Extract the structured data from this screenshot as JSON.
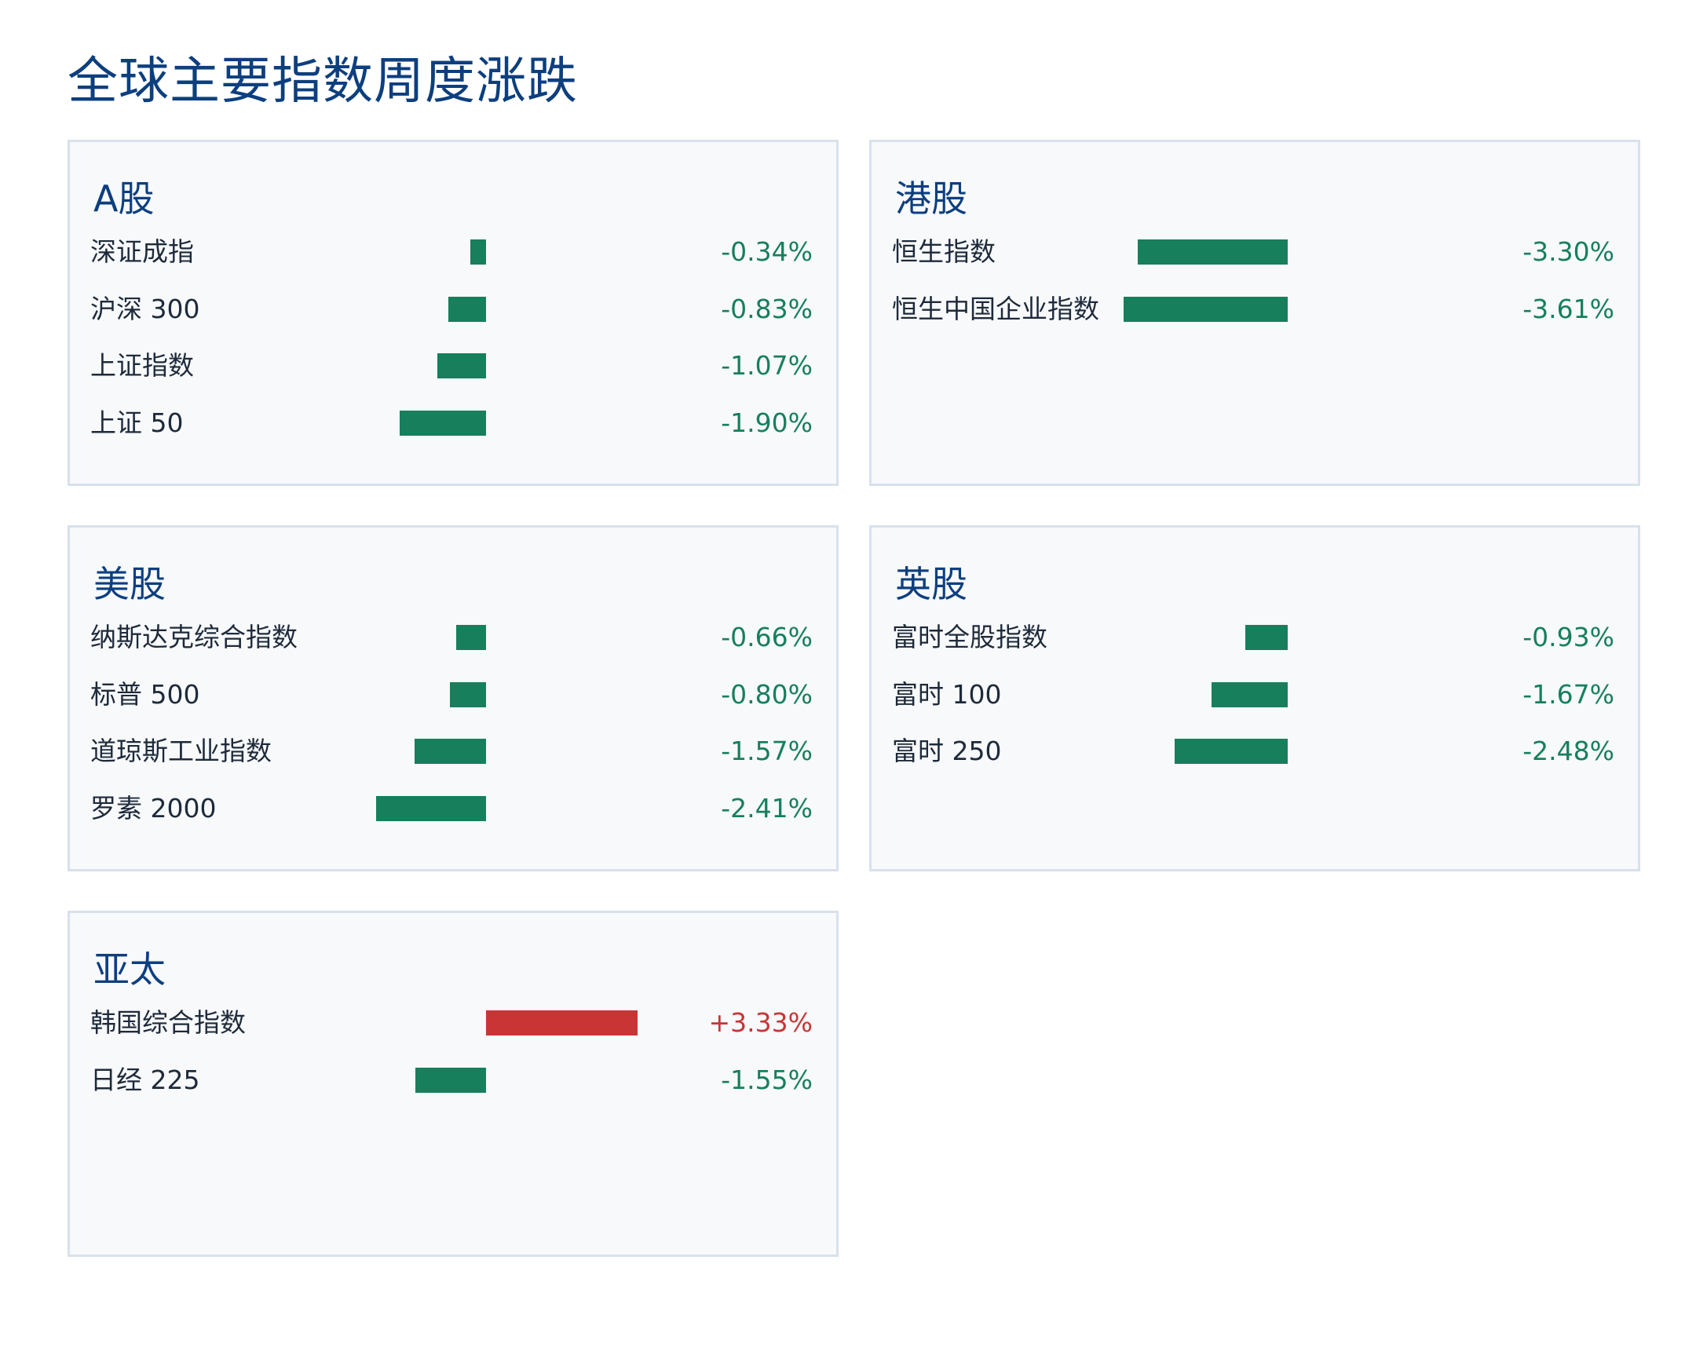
{
  "title": "全球主要指数周度涨跌",
  "colors": {
    "down": "#177f5c",
    "up": "#c93535",
    "title": "#0d3f7f"
  },
  "chart_data": [
    {
      "type": "bar",
      "title": "A股",
      "categories": [
        "深证成指",
        "沪深 300",
        "上证指数",
        "上证 50"
      ],
      "values": [
        -0.34,
        -0.83,
        -1.07,
        -1.9
      ],
      "labels": [
        "-0.34%",
        "-0.83%",
        "-1.07%",
        "-1.90%"
      ]
    },
    {
      "type": "bar",
      "title": "港股",
      "categories": [
        "恒生指数",
        "恒生中国企业指数"
      ],
      "values": [
        -3.3,
        -3.61
      ],
      "labels": [
        "-3.30%",
        "-3.61%"
      ]
    },
    {
      "type": "bar",
      "title": "美股",
      "categories": [
        "纳斯达克综合指数",
        "标普 500",
        "道琼斯工业指数",
        "罗素 2000"
      ],
      "values": [
        -0.66,
        -0.8,
        -1.57,
        -2.41
      ],
      "labels": [
        "-0.66%",
        "-0.80%",
        "-1.57%",
        "-2.41%"
      ]
    },
    {
      "type": "bar",
      "title": "英股",
      "categories": [
        "富时全股指数",
        "富时 100",
        "富时 250"
      ],
      "values": [
        -0.93,
        -1.67,
        -2.48
      ],
      "labels": [
        "-0.93%",
        "-1.67%",
        "-2.48%"
      ]
    },
    {
      "type": "bar",
      "title": "亚太",
      "categories": [
        "韩国综合指数",
        "日经 225"
      ],
      "values": [
        3.33,
        -1.55
      ],
      "labels": [
        "+3.33%",
        "-1.55%"
      ]
    }
  ]
}
